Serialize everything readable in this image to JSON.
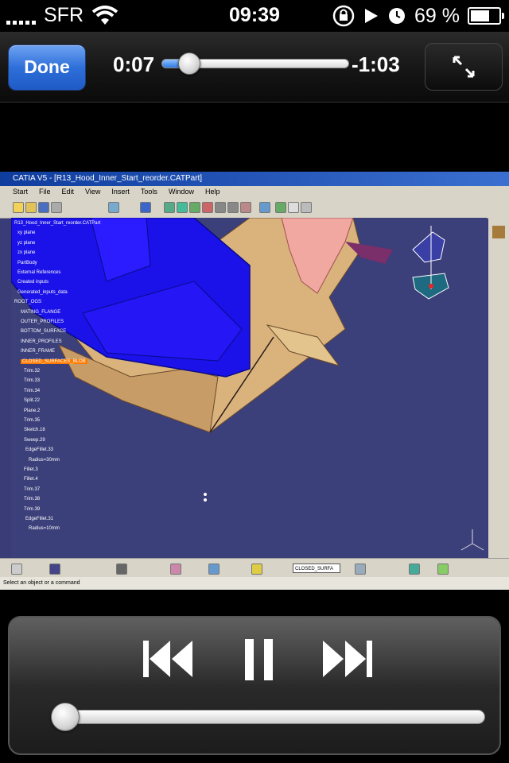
{
  "status_bar": {
    "carrier": "SFR",
    "time": "09:39",
    "battery_percent": "69 %",
    "battery_level": 0.69,
    "signal_bars": 5
  },
  "top_bar": {
    "done_label": "Done",
    "elapsed": "0:07",
    "remaining": "-1:03",
    "progress": 0.1
  },
  "video": {
    "app_title": "CATIA V5 - [R13_Hood_Inner_Start_reorder.CATPart]",
    "menu": [
      "Start",
      "File",
      "Edit",
      "View",
      "Insert",
      "Tools",
      "Window",
      "Help"
    ],
    "tree": [
      "R13_Hood_Inner_Start_reorder.CATPart",
      "xy plane",
      "yz plane",
      "zx plane",
      "PartBody",
      "External References",
      "Created inputs",
      "Generated_inputs_data",
      "ROOT_OGS",
      "MATING_FLANGE",
      "OUTER_PROFILES",
      "BOTTOM_SURFACE",
      "INNER_PROFILES",
      "INNER_FRAME",
      "CLOSED_SURFACES_BLOB",
      "Trim.32",
      "Trim.33",
      "Trim.34",
      "Split.22",
      "Plane.2",
      "Trim.35",
      "Sketch.18",
      "Sweep.29",
      "EdgeFillet.33",
      "Radius=30mm",
      "Fillet.3",
      "Fillet.4",
      "Trim.37",
      "Trim.38",
      "Trim.39",
      "EdgeFillet.31",
      "Radius=10mm"
    ],
    "combo_value": "CLOSED_SURFA",
    "status_text": "Select an object or a command"
  },
  "playback": {
    "position": 0.03
  }
}
